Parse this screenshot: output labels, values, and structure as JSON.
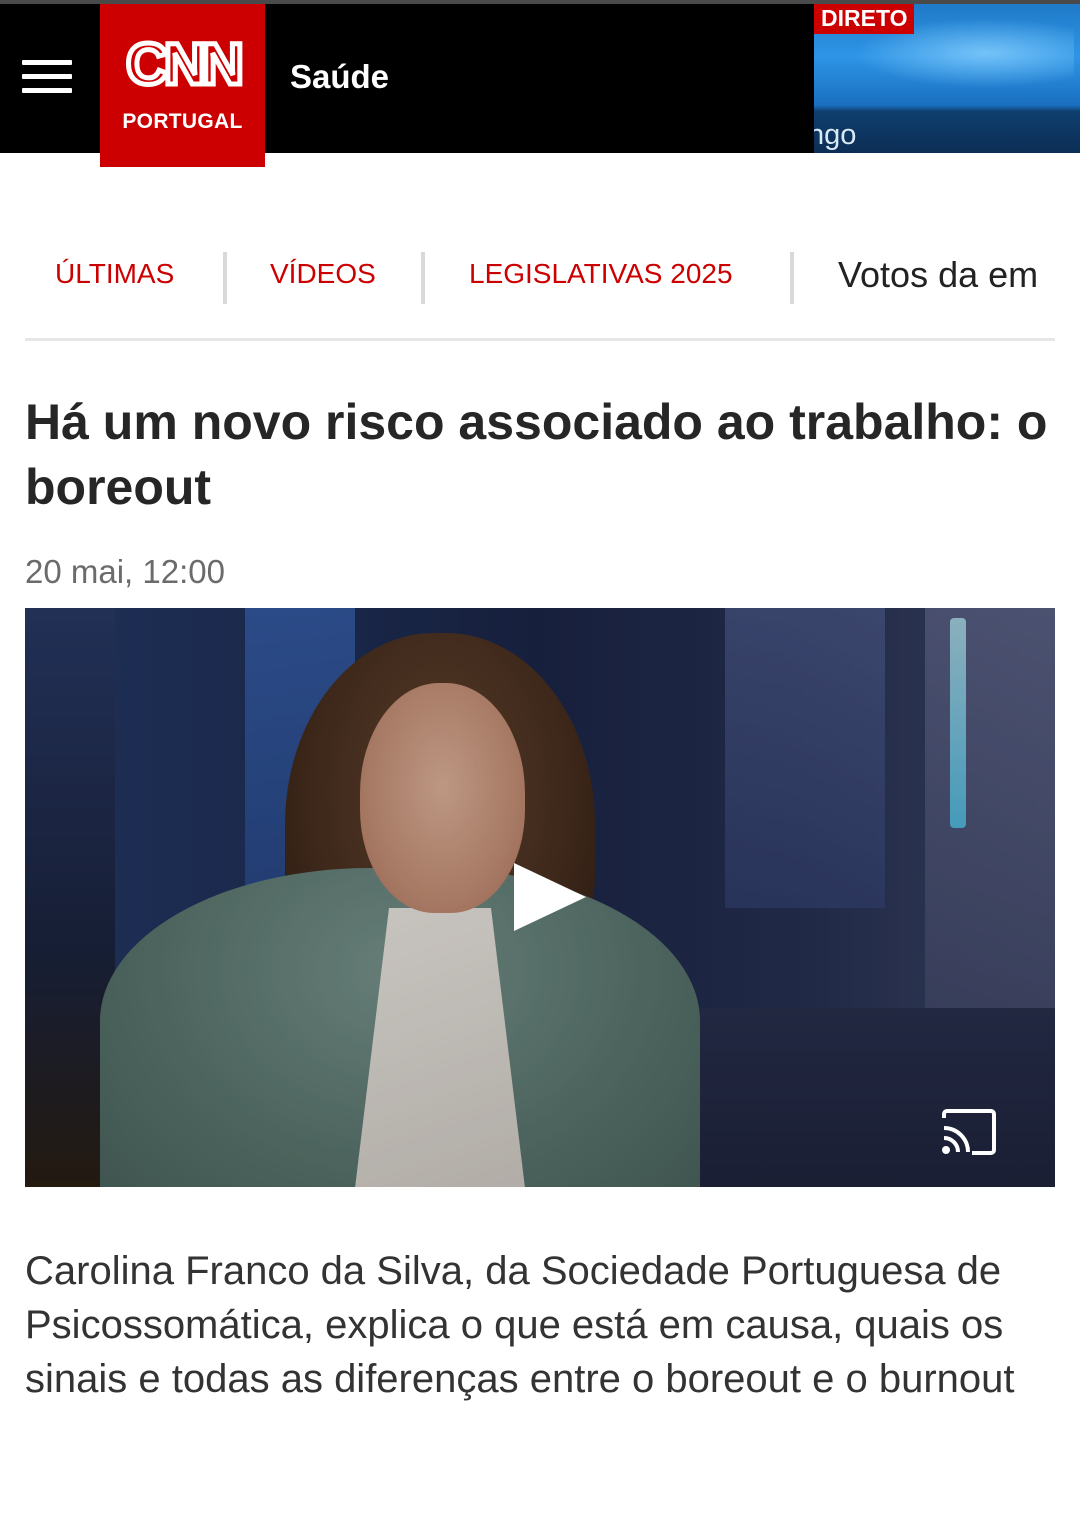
{
  "header": {
    "menu_icon": "hamburger-menu-icon",
    "logo_primary": "CNN",
    "logo_secondary": "PORTUGAL",
    "section_title": "Saúde",
    "live": {
      "badge": "DIRETO",
      "caption": "ngo"
    },
    "colors": {
      "brand_red": "#cc0000",
      "bar_bg": "#000000"
    }
  },
  "nav": {
    "items": [
      {
        "label": "ÚLTIMAS"
      },
      {
        "label": "VÍDEOS"
      },
      {
        "label": "LEGISLATIVAS 2025"
      },
      {
        "label": "Votos da em"
      }
    ]
  },
  "article": {
    "headline": "Há um novo risco associado ao trabalho: o boreout",
    "timestamp": "20 mai, 12:00",
    "video": {
      "play_icon": "play-icon",
      "cast_icon": "cast-icon"
    },
    "lede": "Carolina Franco da Silva, da Sociedade Portuguesa de Psicossomática, explica o que está em causa, quais os sinais e todas as diferenças entre o boreout e o burnout"
  }
}
